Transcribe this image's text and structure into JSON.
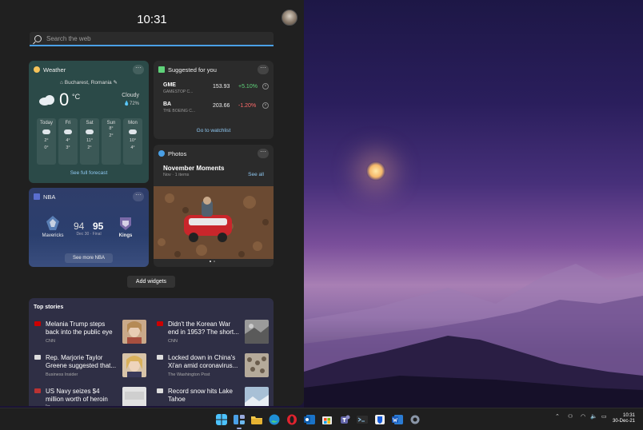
{
  "clock": {
    "time": "10:31"
  },
  "search": {
    "placeholder": "Search the web"
  },
  "weather": {
    "title": "Weather",
    "location": "Bucharest, Romania",
    "temp": "0",
    "unit": "°C",
    "condition": "Cloudy",
    "precip": "72%",
    "forecast": [
      {
        "day": "Today",
        "hi": "2°",
        "lo": "0°",
        "icon": "cloud-icon"
      },
      {
        "day": "Fri",
        "hi": "4°",
        "lo": "3°",
        "icon": "cloud-icon"
      },
      {
        "day": "Sat",
        "hi": "11°",
        "lo": "2°",
        "icon": "cloud-icon"
      },
      {
        "day": "Sun",
        "hi": "8°",
        "lo": "2°",
        "icon": "partly-sunny-icon"
      },
      {
        "day": "Mon",
        "hi": "10°",
        "lo": "4°",
        "icon": "cloud-icon"
      }
    ],
    "link": "See full forecast"
  },
  "stocks": {
    "title": "Suggested for you",
    "items": [
      {
        "symbol": "GME",
        "name": "GAMESTOP C...",
        "price": "153.93",
        "change": "+5.10%",
        "color": "#5fd37a"
      },
      {
        "symbol": "BA",
        "name": "THE BOEING C...",
        "price": "203.66",
        "change": "-1.20%",
        "color": "#ff6b6b"
      }
    ],
    "link": "Go to watchlist"
  },
  "photos": {
    "title": "Photos",
    "heading": "November Moments",
    "sub": "Nov · 1 items",
    "see_all": "See all"
  },
  "nba": {
    "title": "NBA",
    "home": {
      "name": "Mavericks",
      "score": "94"
    },
    "away": {
      "name": "Kings",
      "score": "95"
    },
    "meta": "Dec 30 · Final",
    "link": "See more NBA"
  },
  "add_widgets": "Add widgets",
  "stories": {
    "title": "Top stories",
    "items": [
      {
        "headline": "Melania Trump steps back into the public eye",
        "source": "CNN",
        "src_color": "#cc0000"
      },
      {
        "headline": "Didn't the Korean War end in 1953? The short...",
        "source": "CNN",
        "src_color": "#cc0000"
      },
      {
        "headline": "Rep. Marjorie Taylor Greene suggested that...",
        "source": "Business Insider",
        "src_color": "#dddddd"
      },
      {
        "headline": "Locked down in China's Xi'an amid coronavirus...",
        "source": "The Washington Post",
        "src_color": "#dddddd"
      },
      {
        "headline": "US Navy seizes $4 million worth of heroin in...",
        "source": "",
        "src_color": "#bb3333"
      },
      {
        "headline": "Record snow hits Lake Tahoe",
        "source": "",
        "src_color": "#dddddd"
      }
    ]
  },
  "taskbar": {
    "time": "10:31",
    "date": "30-Dec-21"
  }
}
